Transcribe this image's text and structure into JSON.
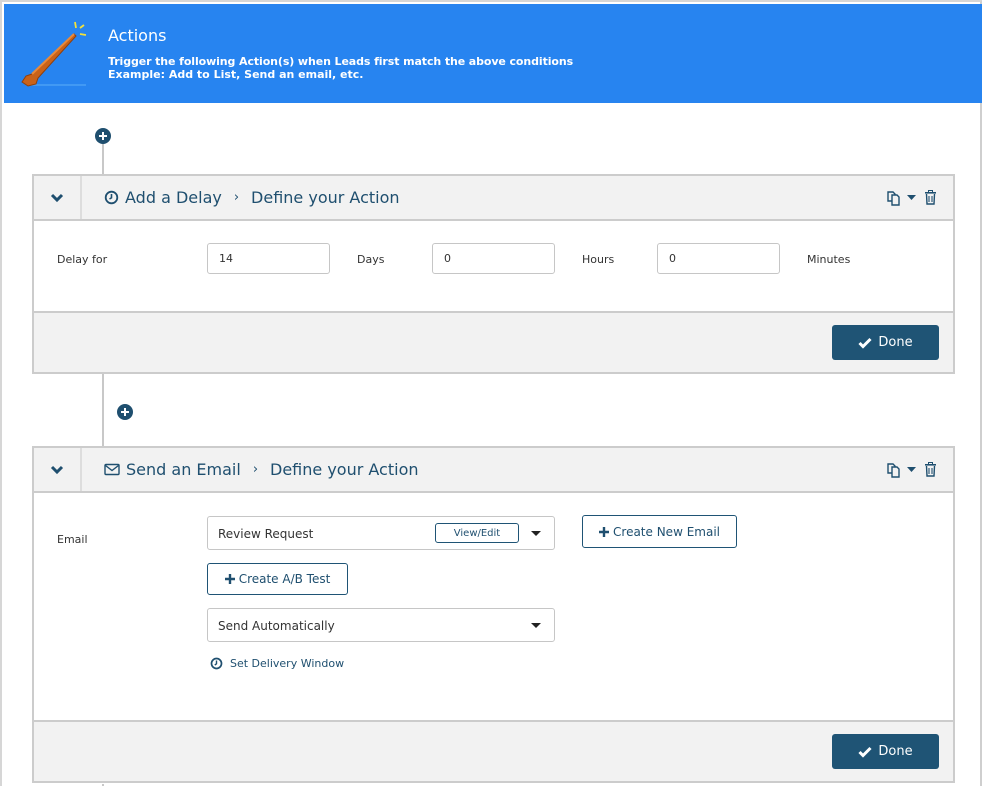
{
  "banner": {
    "title": "Actions",
    "subtitle": "Trigger the following Action(s) when Leads first match the above conditions",
    "example_label": "Example:",
    "example_text": " Add to List, Send an email, etc.",
    "icon": "magic-wand-icon"
  },
  "colors": {
    "banner_bg": "#2784f0",
    "primary": "#1f5475",
    "header_bg": "#f2f2f2",
    "border": "#cccccc"
  },
  "actions": [
    {
      "type_label": "Add a Delay",
      "type_icon": "clock-icon",
      "step_label": "Define your Action",
      "separator": "›",
      "delay": {
        "label": "Delay for",
        "days_value": "14",
        "days_unit": "Days",
        "hours_value": "0",
        "hours_unit": "Hours",
        "minutes_value": "0",
        "minutes_unit": "Minutes"
      },
      "done_label": "Done"
    },
    {
      "type_label": "Send an Email",
      "type_icon": "envelope-icon",
      "step_label": "Define your Action",
      "separator": "›",
      "email": {
        "label": "Email",
        "selected_email": "Review Request",
        "view_edit_label": "View/Edit",
        "create_new_label": "Create New Email",
        "create_ab_label": "Create A/B Test",
        "send_mode": "Send Automatically",
        "delivery_window_label": "Set Delivery Window"
      },
      "done_label": "Done"
    }
  ]
}
